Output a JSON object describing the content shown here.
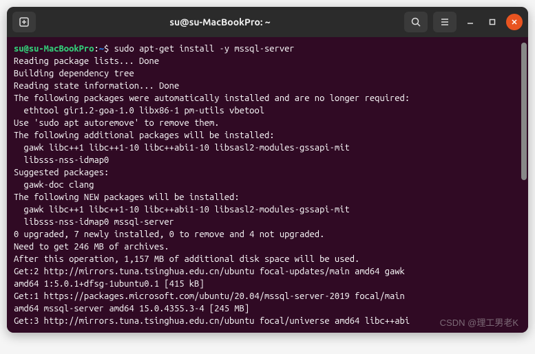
{
  "titlebar": {
    "title": "su@su-MacBookPro: ~"
  },
  "prompt": {
    "user_host": "su@su-MacBookPro",
    "separator": ":",
    "path": "~",
    "symbol": "$",
    "command": "sudo apt-get install -y mssql-server"
  },
  "output": {
    "lines": [
      "Reading package lists... Done",
      "Building dependency tree",
      "Reading state information... Done",
      "The following packages were automatically installed and are no longer required:",
      "  ethtool gir1.2-goa-1.0 libx86-1 pm-utils vbetool",
      "Use 'sudo apt autoremove' to remove them.",
      "The following additional packages will be installed:",
      "  gawk libc++1 libc++1-10 libc++abi1-10 libsasl2-modules-gssapi-mit",
      "  libsss-nss-idmap0",
      "Suggested packages:",
      "  gawk-doc clang",
      "The following NEW packages will be installed:",
      "  gawk libc++1 libc++1-10 libc++abi1-10 libsasl2-modules-gssapi-mit",
      "  libsss-nss-idmap0 mssql-server",
      "0 upgraded, 7 newly installed, 0 to remove and 4 not upgraded.",
      "Need to get 246 MB of archives.",
      "After this operation, 1,157 MB of additional disk space will be used.",
      "Get:2 http://mirrors.tuna.tsinghua.edu.cn/ubuntu focal-updates/main amd64 gawk",
      "amd64 1:5.0.1+dfsg-1ubuntu0.1 [415 kB]",
      "Get:1 https://packages.microsoft.com/ubuntu/20.04/mssql-server-2019 focal/main",
      "amd64 mssql-server amd64 15.0.4355.3-4 [245 MB]",
      "Get:3 http://mirrors.tuna.tsinghua.edu.cn/ubuntu focal/universe amd64 libc++abi"
    ]
  },
  "watermark": "CSDN @理工男老K"
}
